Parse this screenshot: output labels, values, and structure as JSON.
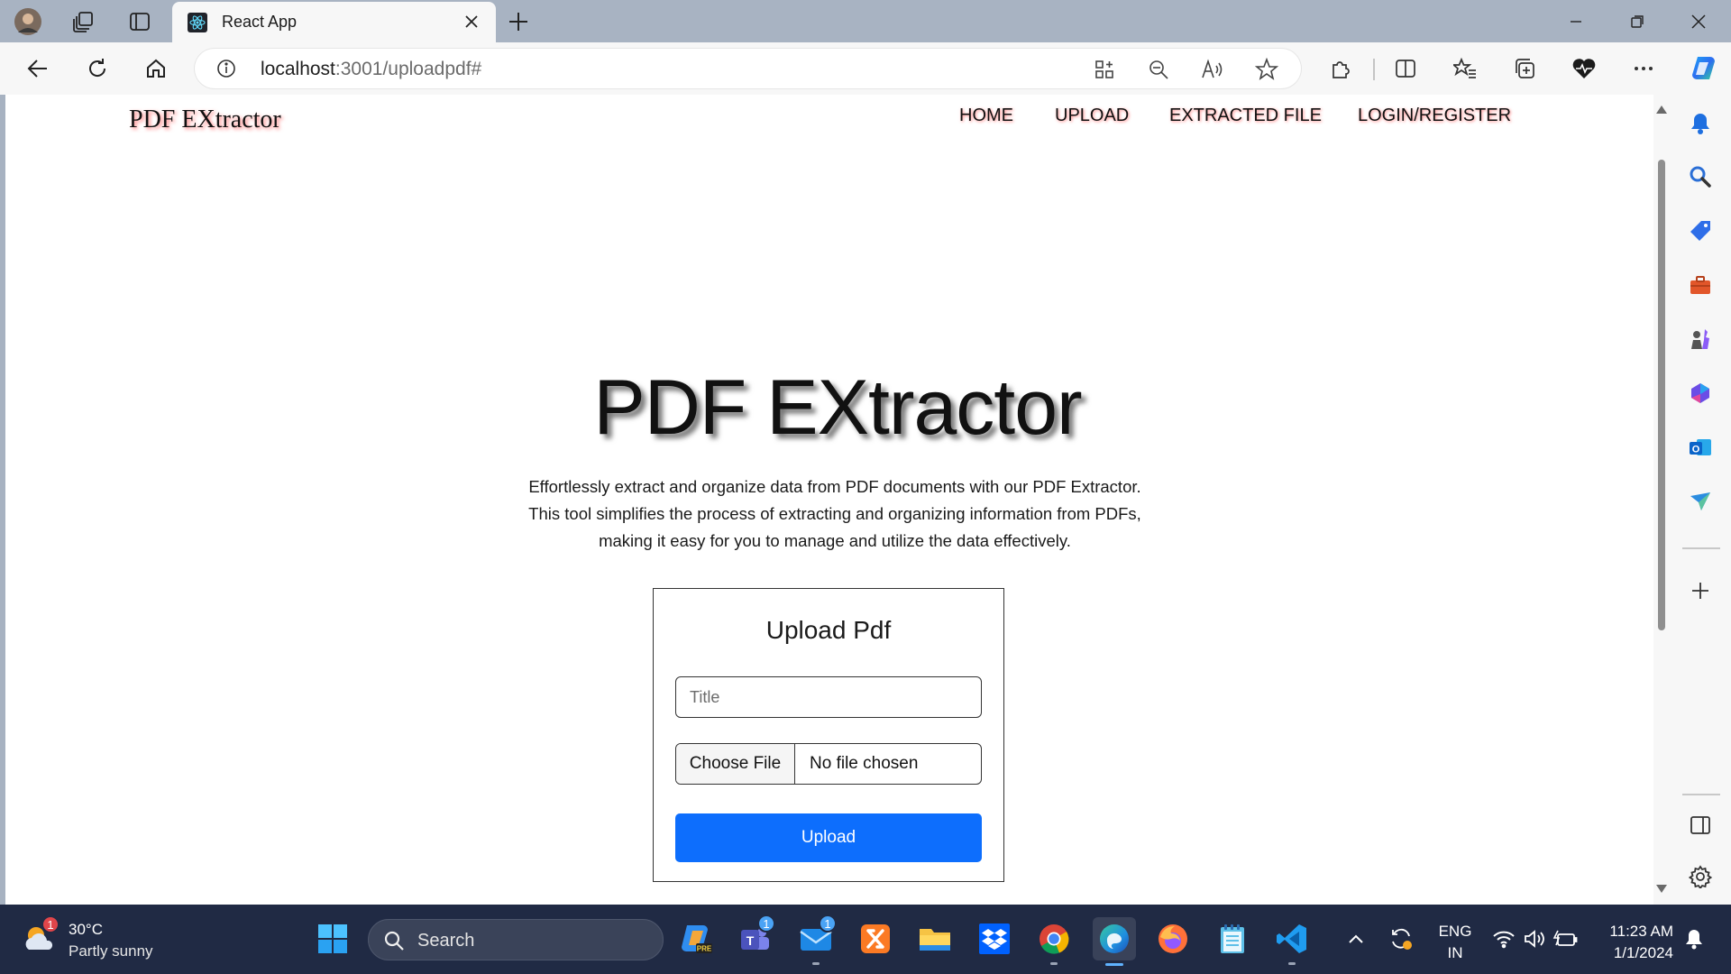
{
  "browser": {
    "tab_title": "React App",
    "url_host": "localhost",
    "url_path": ":3001/uploadpdf#"
  },
  "page": {
    "brand": "PDF EXtractor",
    "nav": [
      "HOME",
      "UPLOAD",
      "EXTRACTED FILE",
      "LOGIN/REGISTER"
    ],
    "hero_title": "PDF EXtractor",
    "hero_description_lines": [
      "Effortlessly extract and organize data from PDF documents with our PDF Extractor.",
      "This tool simplifies the process of extracting and organizing information from PDFs,",
      "making it easy for you to manage and utilize the data effectively."
    ],
    "upload_card": {
      "heading": "Upload Pdf",
      "title_placeholder": "Title",
      "choose_file_label": "Choose File",
      "file_status": "No file chosen",
      "upload_button": "Upload"
    }
  },
  "taskbar": {
    "weather_temp": "30°C",
    "weather_condition": "Partly sunny",
    "weather_badge": "1",
    "search_label": "Search",
    "teams_badge": "1",
    "mail_badge": "1",
    "lang_line1": "ENG",
    "lang_line2": "IN",
    "time": "11:23 AM",
    "date": "1/1/2024"
  },
  "colors": {
    "accent_button": "#0d6efd",
    "taskbar_bg": "#202a44",
    "tabstrip_bg": "#a8b3c2"
  }
}
